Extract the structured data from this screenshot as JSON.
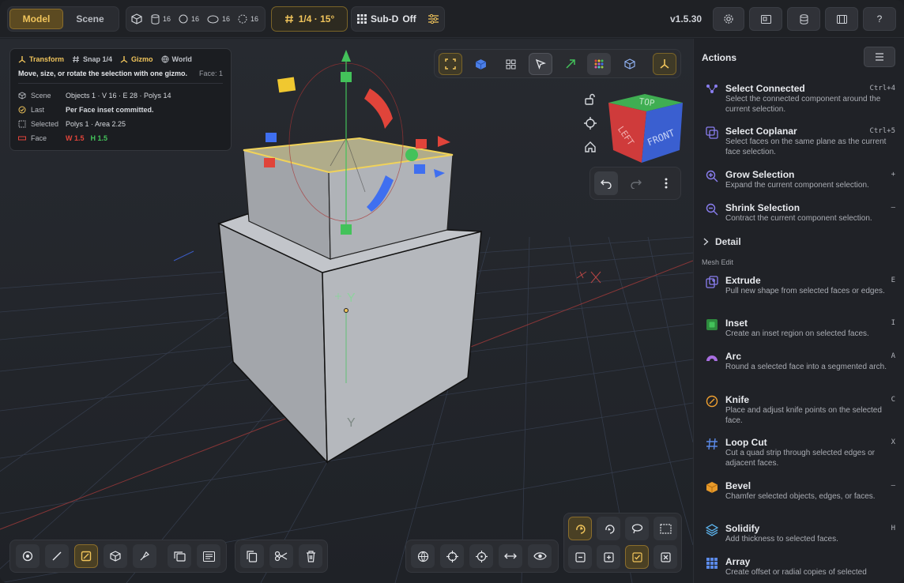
{
  "topbar": {
    "mode_tabs": [
      "Model",
      "Scene"
    ],
    "counts": [
      "16",
      "16",
      "16",
      "16"
    ],
    "grid_label": "1/4 · 15°",
    "subd_label": "Sub-D",
    "subd_state": "Off",
    "version": "v1.5.30",
    "help_label": "?"
  },
  "info": {
    "tools": [
      "Transform",
      "Snap 1/4",
      "Gizmo",
      "World"
    ],
    "description": "Move, size, or rotate the selection with one gizmo.",
    "face_label": "Face: 1",
    "rows": [
      {
        "key": "Scene",
        "value": "Objects 1 · V 16 · E 28 · Polys 14"
      },
      {
        "key": "Last",
        "value": "Per Face inset committed."
      },
      {
        "key": "Selected",
        "value": "Polys 1 · Area 2.25"
      },
      {
        "key": "Face",
        "w": "W 1.5",
        "h": "H 1.5"
      }
    ]
  },
  "viewcube": {
    "top": "TOP",
    "left": "LEFT",
    "front": "FRONT"
  },
  "viewport_labels": {
    "axis_y": "Y"
  },
  "panel": {
    "title": "Actions",
    "detail_label": "Detail",
    "section_label": "Mesh Edit",
    "top_actions": [
      {
        "name": "Select Connected",
        "shortcut": "Ctrl+4",
        "desc": "Select the connected component around the current selection."
      },
      {
        "name": "Select Coplanar",
        "shortcut": "Ctrl+5",
        "desc": "Select faces on the same plane as the current face selection."
      },
      {
        "name": "Grow Selection",
        "shortcut": "+",
        "desc": "Expand the current component selection."
      },
      {
        "name": "Shrink Selection",
        "shortcut": "–",
        "desc": "Contract the current component selection."
      }
    ],
    "mesh_actions": [
      {
        "name": "Extrude",
        "shortcut": "E",
        "desc": "Pull new shape from selected faces or edges."
      },
      {
        "name": "Inset",
        "shortcut": "I",
        "desc": "Create an inset region on selected faces."
      },
      {
        "name": "Arc",
        "shortcut": "A",
        "desc": "Round a selected face into a segmented arch."
      },
      {
        "name": "Knife",
        "shortcut": "C",
        "desc": "Place and adjust knife points on the selected face."
      },
      {
        "name": "Loop Cut",
        "shortcut": "X",
        "desc": "Cut a quad strip through selected edges or adjacent faces."
      },
      {
        "name": "Bevel",
        "shortcut": "–",
        "desc": "Chamfer selected objects, edges, or faces."
      },
      {
        "name": "Solidify",
        "shortcut": "H",
        "desc": "Add thickness to selected faces."
      },
      {
        "name": "Array",
        "shortcut": "",
        "desc": "Create offset or radial copies of selected"
      }
    ]
  },
  "colors": {
    "accent": "#f0c45b",
    "accent_bg": "#5c4a21",
    "red": "#e0443a",
    "green": "#43c25a",
    "blue": "#3f6ff0"
  }
}
